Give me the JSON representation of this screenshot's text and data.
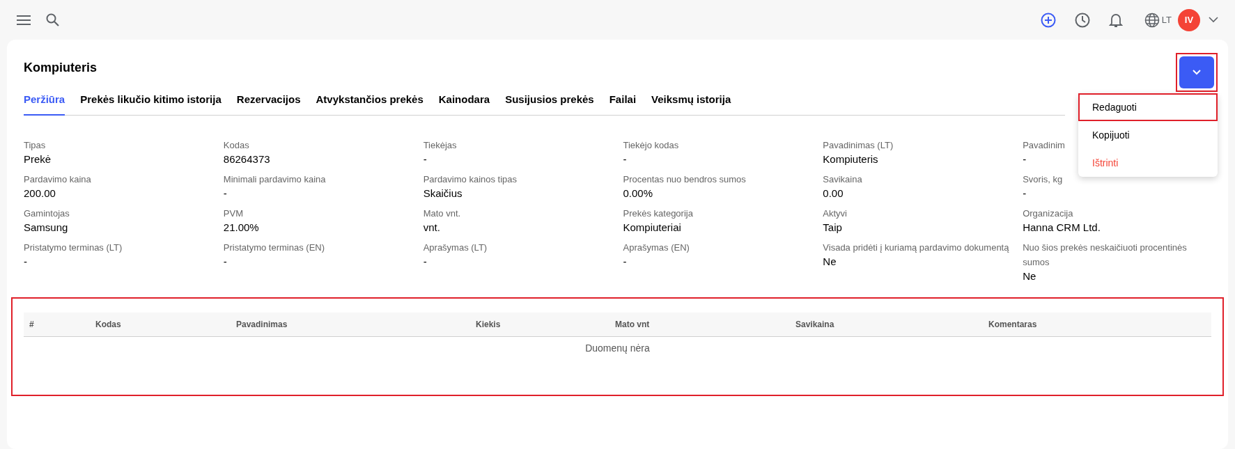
{
  "top_bar": {
    "language": "LT",
    "avatar_initials": "IV"
  },
  "page": {
    "title": "Kompiuteris",
    "actions_button": {
      "highlighted": true
    }
  },
  "tabs": [
    {
      "label": "Peržiūra",
      "selected": true
    },
    {
      "label": "Prekės likučio kitimo istorija",
      "selected": false
    },
    {
      "label": "Rezervacijos",
      "selected": false
    },
    {
      "label": "Atvykstančios prekės",
      "selected": false
    },
    {
      "label": "Kainodara",
      "selected": false
    },
    {
      "label": "Susijusios prekės",
      "selected": false
    },
    {
      "label": "Failai",
      "selected": false
    },
    {
      "label": "Veiksmų istorija",
      "selected": false
    }
  ],
  "actions_menu": [
    {
      "label": "Redaguoti",
      "kind": "normal",
      "highlighted": true
    },
    {
      "label": "Kopijuoti",
      "kind": "normal",
      "highlighted": false
    },
    {
      "label": "Ištrinti",
      "kind": "danger",
      "highlighted": false
    }
  ],
  "fields": [
    {
      "label": "Tipas",
      "value": "Prekė"
    },
    {
      "label": "Kodas",
      "value": "86264373"
    },
    {
      "label": "Tiekėjas",
      "value": "-"
    },
    {
      "label": "Tiekėjo kodas",
      "value": "-"
    },
    {
      "label": "Pavadinimas (LT)",
      "value": "Kompiuteris"
    },
    {
      "label": "Pavadinim",
      "value": "-"
    },
    {
      "label": "Pardavimo kaina",
      "value": "200.00"
    },
    {
      "label": "Minimali pardavimo kaina",
      "value": "-"
    },
    {
      "label": "Pardavimo kainos tipas",
      "value": "Skaičius"
    },
    {
      "label": "Procentas nuo bendros sumos",
      "value": "0.00%"
    },
    {
      "label": "Savikaina",
      "value": "0.00"
    },
    {
      "label": "Svoris, kg",
      "value": "-"
    },
    {
      "label": "Gamintojas",
      "value": "Samsung"
    },
    {
      "label": "PVM",
      "value": "21.00%"
    },
    {
      "label": "Mato vnt.",
      "value": "vnt."
    },
    {
      "label": "Prekės kategorija",
      "value": "Kompiuteriai"
    },
    {
      "label": "Aktyvi",
      "value": "Taip"
    },
    {
      "label": "Organizacija",
      "value": "Hanna CRM Ltd."
    },
    {
      "label": "Pristatymo terminas (LT)",
      "value": "-"
    },
    {
      "label": "Pristatymo terminas (EN)",
      "value": "-"
    },
    {
      "label": "Aprašymas (LT)",
      "value": "-"
    },
    {
      "label": "Aprašymas (EN)",
      "value": "-"
    },
    {
      "label": "Visada pridėti į kuriamą pardavimo dokumentą",
      "value": "Ne"
    },
    {
      "label": "Nuo šios prekės neskaičiuoti procentinės sumos",
      "value": "Ne"
    }
  ],
  "table": {
    "highlighted": true,
    "columns": [
      "#",
      "Kodas",
      "Pavadinimas",
      "Kiekis",
      "Mato vnt",
      "Savikaina",
      "Komentaras"
    ],
    "empty_text": "Duomenų nėra"
  }
}
